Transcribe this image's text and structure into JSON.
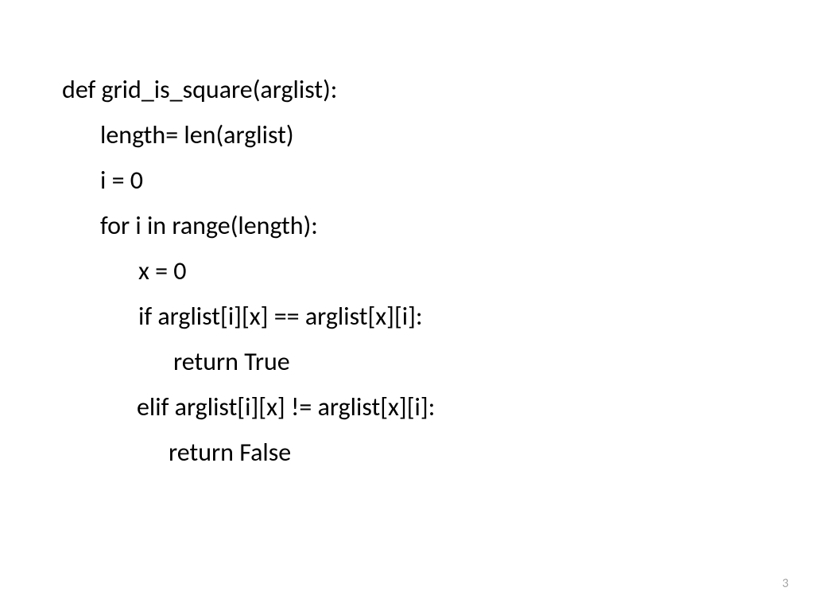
{
  "code": {
    "line1": "def grid_is_square(arglist):",
    "line2": "length= len(arglist)",
    "line3": "i = 0",
    "line4": "for i in range(length):",
    "line5": "x = 0",
    "line6": "if arglist[i][x] == arglist[x][i]:",
    "line7": "return True",
    "line8": "elif arglist[i][x] != arglist[x][i]:",
    "line9": "return False"
  },
  "page_number": "3"
}
